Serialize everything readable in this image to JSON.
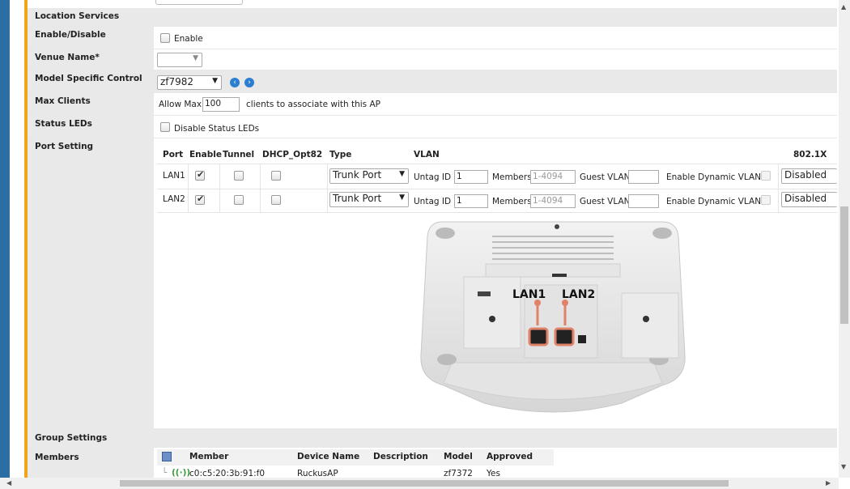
{
  "sections": {
    "location_services": "Location Services",
    "group_settings": "Group Settings"
  },
  "fields": {
    "enable_disable": {
      "label": "Enable/Disable",
      "checkbox_label": "Enable"
    },
    "venue_name": {
      "label": "Venue Name*",
      "value": ""
    },
    "model_specific": {
      "label": "Model Specific Control",
      "model_value": "zf7982"
    },
    "max_clients": {
      "label": "Max Clients",
      "prefix": "Allow Max",
      "value": "100",
      "suffix": "clients to associate with this AP"
    },
    "status_leds": {
      "label": "Status LEDs",
      "checkbox_label": "Disable Status LEDs"
    },
    "port_setting": {
      "label": "Port Setting"
    },
    "members": {
      "label": "Members"
    }
  },
  "port_table": {
    "headers": {
      "port": "Port",
      "enable": "Enable",
      "tunnel": "Tunnel",
      "dhcp": "DHCP_Opt82",
      "type": "Type",
      "vlan": "VLAN",
      "dot1x": "802.1X"
    },
    "rows": [
      {
        "port": "LAN1",
        "enable": true,
        "tunnel": false,
        "dhcp": false,
        "type": "Trunk Port",
        "untag_label": "Untag ID",
        "untag": "1",
        "members_label": "Members",
        "members_placeholder": "1-4094",
        "guest_label": "Guest VLAN",
        "guest": "",
        "dynamic_label": "Enable Dynamic VLAN",
        "dot1x": "Disabled"
      },
      {
        "port": "LAN2",
        "enable": true,
        "tunnel": false,
        "dhcp": false,
        "type": "Trunk Port",
        "untag_label": "Untag ID",
        "untag": "1",
        "members_label": "Members",
        "members_placeholder": "1-4094",
        "guest_label": "Guest VLAN",
        "guest": "",
        "dynamic_label": "Enable Dynamic VLAN",
        "dot1x": "Disabled"
      }
    ]
  },
  "ap_image": {
    "lan1": "LAN1",
    "lan2": "LAN2",
    "accent": "#e0826a"
  },
  "members_table": {
    "headers": {
      "member": "Member",
      "device_name": "Device Name",
      "description": "Description",
      "model": "Model",
      "approved": "Approved"
    },
    "rows": [
      {
        "member": "c0:c5:20:3b:91:f0",
        "device_name": "RuckusAP",
        "description": "",
        "model": "zf7372",
        "approved": "Yes"
      }
    ]
  },
  "colors": {
    "sidebar": "#2c6ea3",
    "accent": "#f0a419",
    "label_bg": "#e9e9e9"
  }
}
